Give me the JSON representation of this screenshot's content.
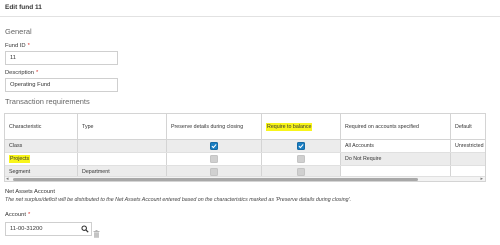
{
  "header": {
    "title": "Edit fund 11"
  },
  "general": {
    "heading": "General",
    "fund_id": {
      "label": "Fund ID",
      "required_mark": "*",
      "value": "11"
    },
    "description": {
      "label": "Description",
      "required_mark": "*",
      "value": "Operating Fund"
    }
  },
  "transaction": {
    "heading": "Transaction requirements",
    "columns": [
      "Characteristic",
      "Type",
      "Preserve details during closing",
      "Require to balance",
      "Required on accounts specified",
      "Default"
    ],
    "rows": [
      {
        "characteristic": "Class",
        "type": "",
        "preserve": "checked",
        "require": "checked",
        "required_on": "All Accounts",
        "default": "Unrestricted"
      },
      {
        "characteristic": "Projects",
        "type": "",
        "preserve": "disabled",
        "require": "disabled",
        "required_on": "Do Not Require",
        "default": ""
      },
      {
        "characteristic": "Segment",
        "type": "Department",
        "preserve": "disabled",
        "require": "disabled",
        "required_on": "",
        "default": ""
      }
    ]
  },
  "net_assets": {
    "title": "Net Assets Account",
    "note": "The net surplus/deficit will be distributed to the Net Assets Account entered based on the characteristics marked as 'Preserve details during closing'.",
    "account": {
      "label": "Account",
      "required_mark": "*",
      "value": "11-00-31200"
    }
  },
  "icons": {
    "search": "search-icon",
    "delete": "trash-icon",
    "check": "checkmark-icon"
  },
  "colors": {
    "highlight": "#f8f51a",
    "checkbox": "#1a7ec2",
    "required": "#d9302b"
  }
}
